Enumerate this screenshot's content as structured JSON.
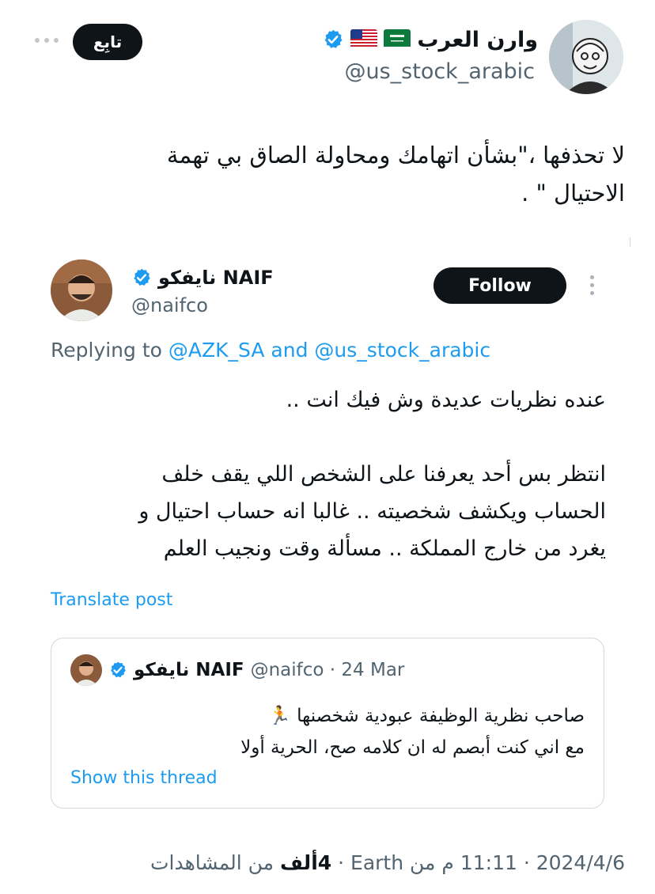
{
  "header": {
    "more_icon": "ellipsis-horizontal",
    "follow_label": "تابِع",
    "display_name": "وارن العرب",
    "handle": "@us_stock_arabic",
    "verified_color": "#1d9bf0"
  },
  "main_post": {
    "line1": "لا تحذفها ،\"بشأن اتهامك ومحاولة الصاق بي تهمة",
    "line2": "الاحتيال \" ."
  },
  "quoted_reply": {
    "display_name": "نايفكو NAIF",
    "handle": "@naifco",
    "follow_label": "Follow",
    "replying_prefix": "Replying to",
    "reply_user_1": "@AZK_SA",
    "reply_and": "and",
    "reply_user_2": "@us_stock_arabic",
    "body_line1": "عنده نظريات عديدة وش فيك انت ..",
    "body_line2": "انتظر بس أحد يعرفنا على الشخص اللي يقف خلف",
    "body_line3": "الحساب ويكشف شخصيته .. غالبا انه حساب احتيال و",
    "body_line4": "يغرد من خارج المملكة .. مسألة وقت ونجيب العلم",
    "translate_label": "Translate post",
    "inner_quote": {
      "display_name": "نايفكو NAIF",
      "handle_date": "@naifco · 24 Mar",
      "line1": "صاحب نظرية الوظيفة عبودية شخصنها 🏃",
      "line2": "مع اني كنت أبصم له ان كلامه صح، الحرية أولا",
      "show_thread": "Show this thread"
    }
  },
  "footer": {
    "date_time": "2024/4/6 · 11:11 م من Earth ·",
    "views_count": "4ألف",
    "views_label": "من المشاهدات"
  }
}
